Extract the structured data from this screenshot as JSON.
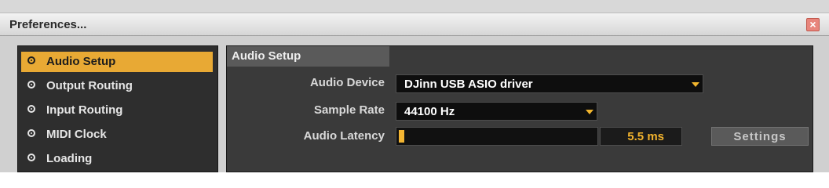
{
  "window": {
    "title": "Preferences..."
  },
  "sidebar": {
    "items": [
      {
        "label": "Audio Setup",
        "active": true
      },
      {
        "label": "Output Routing"
      },
      {
        "label": "Input Routing"
      },
      {
        "label": "MIDI Clock"
      },
      {
        "label": "Loading"
      }
    ]
  },
  "panel": {
    "header": "Audio Setup",
    "audio_device": {
      "label": "Audio Device",
      "value": "DJinn USB ASIO driver"
    },
    "sample_rate": {
      "label": "Sample Rate",
      "value": "44100 Hz"
    },
    "audio_latency": {
      "label": "Audio Latency",
      "value": "5.5 ms",
      "level_fraction": 0.03
    },
    "settings_label": "Settings"
  },
  "colors": {
    "accent": "#e8a934",
    "panel_bg": "#3a3a3a",
    "sidebar_bg": "#2e2e2e"
  }
}
